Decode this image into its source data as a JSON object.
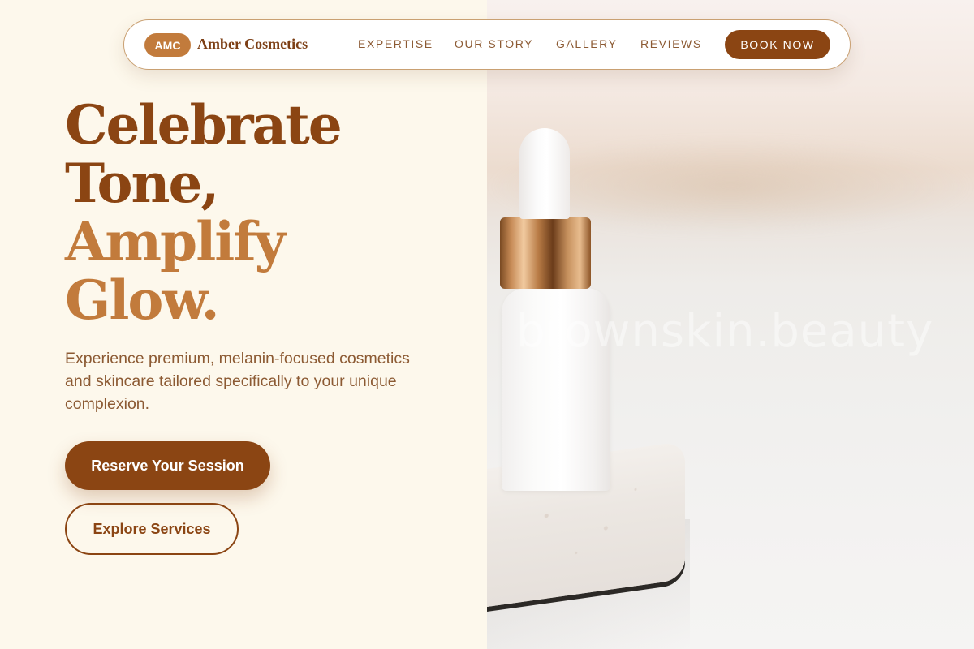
{
  "brand": {
    "badge": "AMC",
    "name": "Amber Cosmetics"
  },
  "nav": {
    "links": [
      "EXPERTISE",
      "OUR STORY",
      "GALLERY",
      "REVIEWS"
    ],
    "cta": "BOOK NOW"
  },
  "hero": {
    "headline_dark": [
      "Celebrate",
      "Tone,"
    ],
    "headline_light": [
      "Amplify",
      "Glow."
    ],
    "subtext": "Experience premium, melanin-focused cosmetics and skincare tailored specifically to your unique complexion.",
    "primary_cta": "Reserve Your Session",
    "secondary_cta": "Explore Services"
  },
  "image": {
    "watermark": "brownskin.beauty"
  },
  "colors": {
    "brand_dark": "#8b4513",
    "brand_light": "#c27b3c",
    "background": "#fdf8ec"
  }
}
